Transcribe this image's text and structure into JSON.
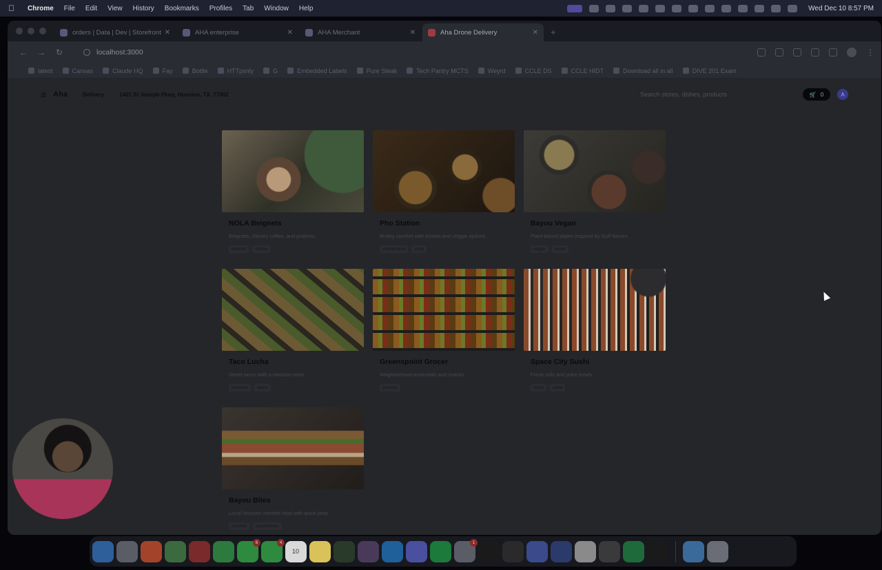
{
  "menubar": {
    "app_name": "Chrome",
    "menus": [
      "File",
      "Edit",
      "View",
      "History",
      "Bookmarks",
      "Profiles",
      "Tab",
      "Window",
      "Help"
    ],
    "clock": "Wed Dec 10  8:57 PM"
  },
  "browser": {
    "tabs": [
      {
        "title": "orders | Data | Dev | Storefront",
        "active": false
      },
      {
        "title": "AHA enterprise",
        "active": false
      },
      {
        "title": "AHA Merchant",
        "active": false
      },
      {
        "title": "Aha Drone Delivery",
        "active": true
      }
    ],
    "url": "localhost:3000",
    "bookmarks": [
      "latest",
      "Canvas",
      "Claude HQ",
      "Fay",
      "Bottle",
      "HTTpsnly",
      "G",
      "Embedded Labels",
      "Pure Steak",
      "Tech Pantry MCTS",
      "Weyrd",
      "CCLE DS",
      "CCLE HIDT",
      "Download all in all",
      "DIVE 201 Exam"
    ]
  },
  "site": {
    "logo": "Aha",
    "mode": "Delivery",
    "address": "1401 St Joseph Pkwy, Houston, TX, 77002",
    "search_placeholder": "Search stores, dishes, products",
    "cart_count": "0",
    "avatar_initial": "A"
  },
  "stores": [
    {
      "name": "NOLA Beignets",
      "desc": "Beignets, chicory coffee, and pralines.",
      "tags": [
        "dessert",
        "coffee"
      ]
    },
    {
      "name": "Pho Station",
      "desc": "Brothy comfort with brisket and veggie options.",
      "tags": [
        "vietnamese",
        "soup"
      ]
    },
    {
      "name": "Bayou Vegan",
      "desc": "Plant-based plates inspired by Gulf flavors.",
      "tags": [
        "vegan",
        "bowls"
      ]
    },
    {
      "name": "Taco Lucha",
      "desc": "Street tacos with a Houston twist.",
      "tags": [
        "mexican",
        "tacos"
      ]
    },
    {
      "name": "Greenspoint Grocer",
      "desc": "Neighborhood essentials and snacks.",
      "tags": [
        "grocery"
      ]
    },
    {
      "name": "Space City Sushi",
      "desc": "Fresh rolls and poke bowls.",
      "tags": [
        "sushi",
        "poke"
      ]
    },
    {
      "name": "Bayou Bites",
      "desc": "Local Houston comfort food with quick prep.",
      "tags": [
        "comfort",
        "sandwiches"
      ]
    }
  ],
  "dock": {
    "badges": {
      "messages": "6",
      "facetime": "4",
      "calendar": "10",
      "settings": "1"
    }
  }
}
